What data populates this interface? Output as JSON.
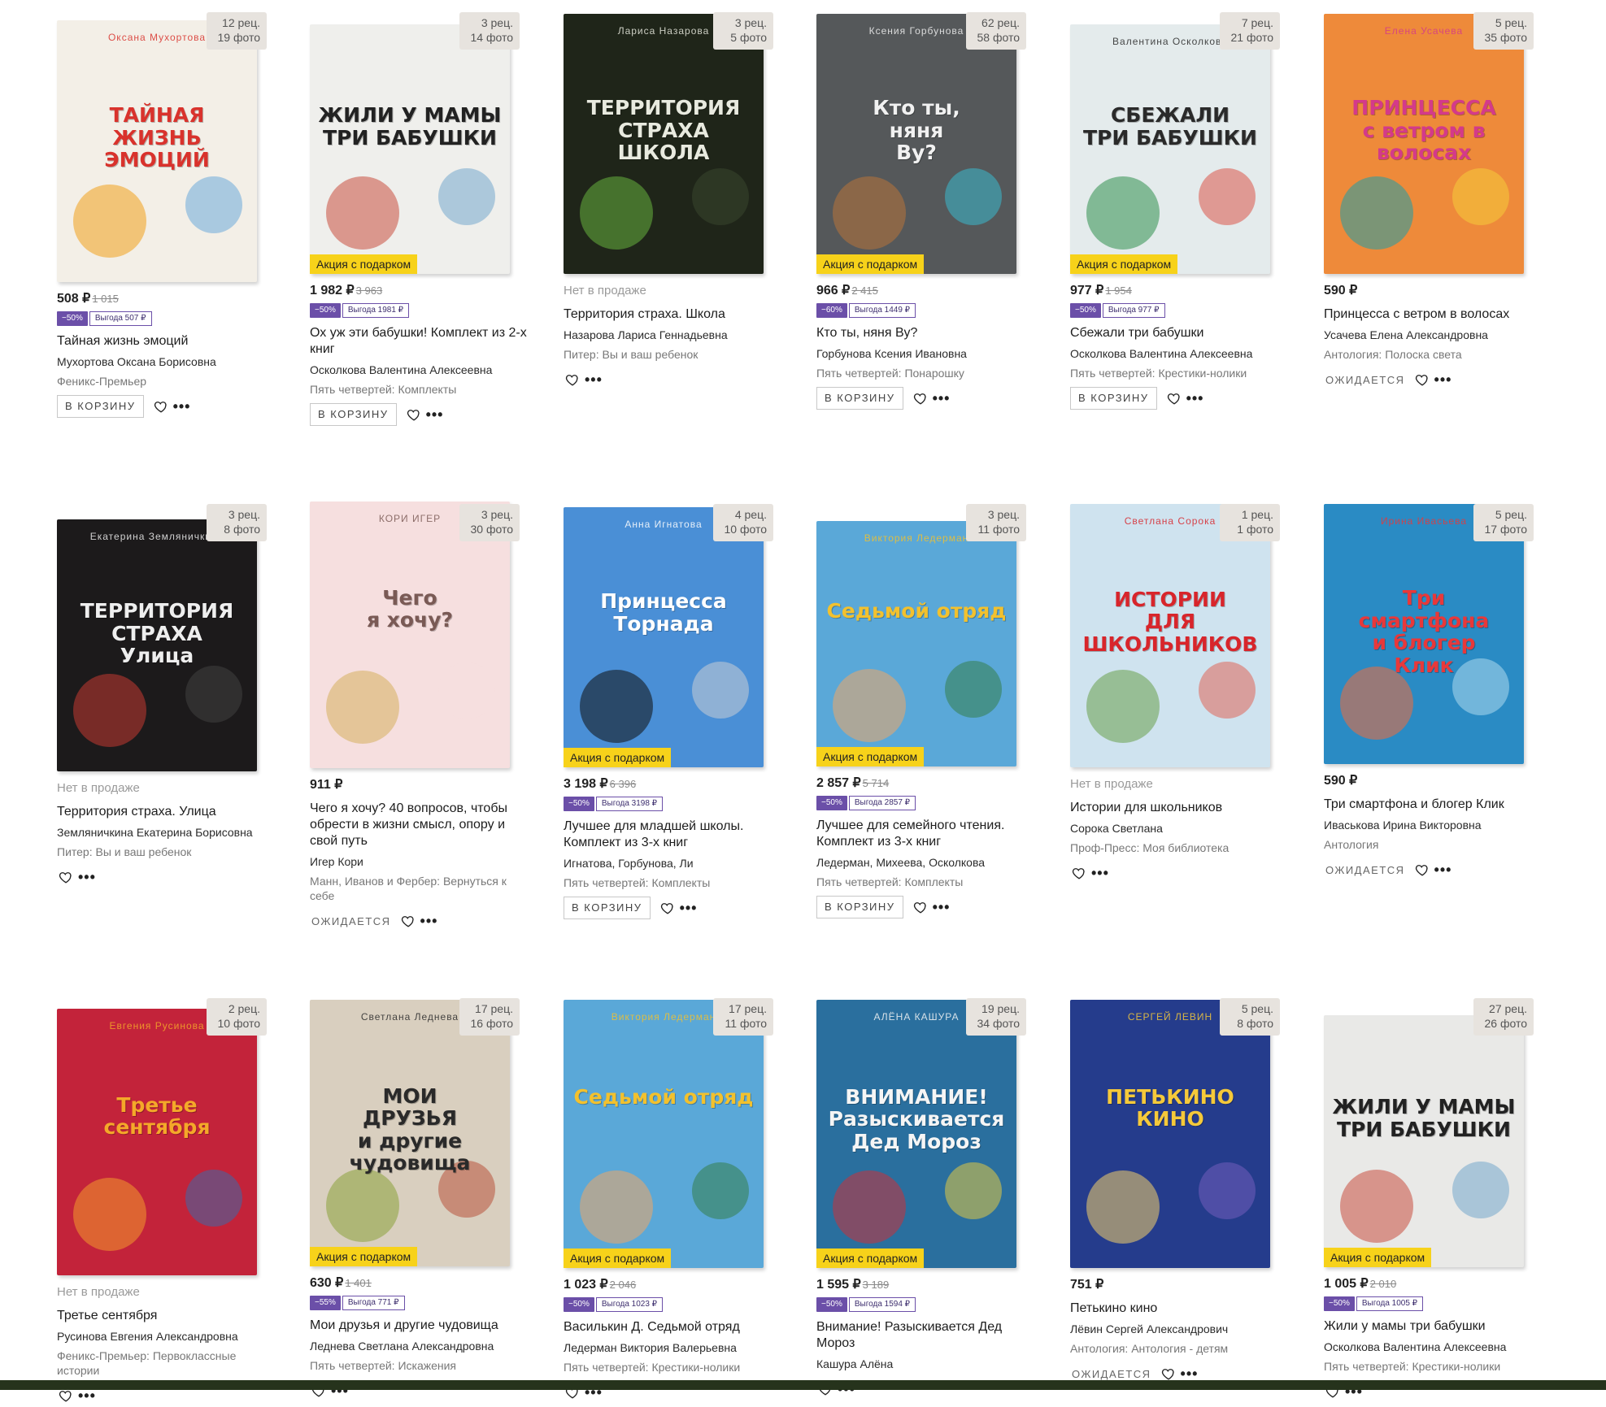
{
  "cards": [
    {
      "title": "Тайная жизнь эмоций",
      "author": "Мухортова Оксана Борисовна",
      "publisher": "Феникс-Премьер",
      "price": "508 ₽",
      "old_price": "1 015",
      "discount": "−50%",
      "saving": "Выгода 507 ₽",
      "reviews": "12 рец.",
      "photos": "19 фото",
      "promo": "",
      "status": "",
      "action": "В КОРЗИНУ",
      "cover_title": "ТАЙНАЯ\nЖИЗНЬ\nЭМОЦИЙ",
      "cover_author": "Оксана Мухортова",
      "cover_bg": "#f3efe7",
      "cover_fg": "#d9322c",
      "deco_a": "#f1a11c",
      "deco_b": "#5fa3d9"
    },
    {
      "title": "Ох уж эти бабушки! Комплект из 2-х книг",
      "author": "Осколкова Валентина Алексеевна",
      "publisher": "Пять четвертей: Комплекты",
      "price": "1 982 ₽",
      "old_price": "3 963",
      "discount": "−50%",
      "saving": "Выгода 1981 ₽",
      "reviews": "3 рец.",
      "photos": "14 фото",
      "promo": "Акция с подарком",
      "status": "",
      "action": "В КОРЗИНУ",
      "cover_title": "ЖИЛИ У МАМЫ\nТРИ БАБУШКИ",
      "cover_author": "",
      "cover_bg": "#efefec",
      "cover_fg": "#222222",
      "deco_a": "#c94f3f",
      "deco_b": "#6aa1c9"
    },
    {
      "title": "Территория страха. Школа",
      "author": "Назарова Лариса Геннадьевна",
      "publisher": "Питер: Вы и ваш ребенок",
      "price": "",
      "old_price": "",
      "discount": "",
      "saving": "",
      "reviews": "3 рец.",
      "photos": "5 фото",
      "promo": "",
      "status": "Нет в продаже",
      "action": "",
      "cover_title": "ТЕРРИТОРИЯ\nСТРАХА\nШКОЛА",
      "cover_author": "Лариса Назарова",
      "cover_bg": "#1f2519",
      "cover_fg": "#e8eadf",
      "deco_a": "#66b33e",
      "deco_b": "#3b4a30"
    },
    {
      "title": "Кто ты, няня Ву?",
      "author": "Горбунова Ксения Ивановна",
      "publisher": "Пять четвертей: Понарошку",
      "price": "966 ₽",
      "old_price": "2 415",
      "discount": "−60%",
      "saving": "Выгода 1449 ₽",
      "reviews": "62 рец.",
      "photos": "58 фото",
      "promo": "Акция с подарком",
      "status": "",
      "action": "В КОРЗИНУ",
      "cover_title": "Кто ты,\nняня\nВу?",
      "cover_author": "Ксения Горбунова",
      "cover_bg": "#55585a",
      "cover_fg": "#f1f1f1",
      "deco_a": "#b8743a",
      "deco_b": "#38c2d8"
    },
    {
      "title": "Сбежали три бабушки",
      "author": "Осколкова Валентина Алексеевна",
      "publisher": "Пять четвертей: Крестики-нолики",
      "price": "977 ₽",
      "old_price": "1 954",
      "discount": "−50%",
      "saving": "Выгода 977 ₽",
      "reviews": "7 рец.",
      "photos": "21 фото",
      "promo": "Акция с подарком",
      "status": "",
      "action": "В КОРЗИНУ",
      "cover_title": "СБЕЖАЛИ\nТРИ БАБУШКИ",
      "cover_author": "Валентина Осколкова",
      "cover_bg": "#e4ebec",
      "cover_fg": "#2a2a2a",
      "deco_a": "#2f8f4e",
      "deco_b": "#d9483a"
    },
    {
      "title": "Принцесса с ветром в волосах",
      "author": "Усачева Елена Александровна",
      "publisher": "Антология: Полоска света",
      "price": "590 ₽",
      "old_price": "",
      "discount": "",
      "saving": "",
      "reviews": "5 рец.",
      "photos": "35 фото",
      "promo": "",
      "status": "",
      "action": "ОЖИДАЕТСЯ",
      "cover_title": "ПРИНЦЕССА\nс ветром в волосах",
      "cover_author": "Елена Усачева",
      "cover_bg": "#ee8a3a",
      "cover_fg": "#d43a8a",
      "deco_a": "#1d9ea8",
      "deco_b": "#f5d23a"
    },
    {
      "title": "Территория страха. Улица",
      "author": "Земляничкина Екатерина Борисовна",
      "publisher": "Питер: Вы и ваш ребенок",
      "price": "",
      "old_price": "",
      "discount": "",
      "saving": "",
      "reviews": "3 рец.",
      "photos": "8 фото",
      "promo": "",
      "status": "Нет в продаже",
      "action": "",
      "cover_title": "ТЕРРИТОРИЯ\nСТРАХА\nУлица",
      "cover_author": "Екатерина Земляничкина",
      "cover_bg": "#1c1a1b",
      "cover_fg": "#eeeeee",
      "deco_a": "#c43a32",
      "deco_b": "#444444"
    },
    {
      "title": "Чего я хочу? 40 вопросов, чтобы обрести в жизни смысл, опору и свой путь",
      "author": "Игер Кори",
      "publisher": "Манн, Иванов и Фербер: Вернуться к себе",
      "price": "911 ₽",
      "old_price": "",
      "discount": "",
      "saving": "",
      "reviews": "3 рец.",
      "photos": "30 фото",
      "promo": "",
      "status": "",
      "action": "ОЖИДАЕТСЯ",
      "cover_title": "Чего\nя хочу?",
      "cover_author": "КОРИ ИГЕР",
      "cover_bg": "#f6dfdf",
      "cover_fg": "#7a5a55",
      "deco_a": "#d6ae5c",
      "deco_b": "#f6dfdf"
    },
    {
      "title": "Лучшее для младшей школы. Комплект из 3-х книг",
      "author": "Игнатова, Горбунова, Ли",
      "publisher": "Пять четвертей: Комплекты",
      "price": "3 198 ₽",
      "old_price": "6 396",
      "discount": "−50%",
      "saving": "Выгода 3198 ₽",
      "reviews": "4 рец.",
      "photos": "10 фото",
      "promo": "Акция с подарком",
      "status": "",
      "action": "В КОРЗИНУ",
      "cover_title": "Принцесса\nТорнада",
      "cover_author": "Анна Игнатова",
      "cover_bg": "#4a8fd6",
      "cover_fg": "#ffffff",
      "deco_a": "#111111",
      "deco_b": "#d3d3d3"
    },
    {
      "title": "Лучшее для семейного чтения. Комплект из 3-х книг",
      "author": "Ледерман, Михеева, Осколкова",
      "publisher": "Пять четвертей: Комплекты",
      "price": "2 857 ₽",
      "old_price": "5 714",
      "discount": "−50%",
      "saving": "Выгода 2857 ₽",
      "reviews": "3 рец.",
      "photos": "11 фото",
      "promo": "Акция с подарком",
      "status": "",
      "action": "В КОРЗИНУ",
      "cover_title": "Седьмой отряд",
      "cover_author": "Виктория Ледерман",
      "cover_bg": "#5aa8d8",
      "cover_fg": "#f2c12e",
      "deco_a": "#f0a566",
      "deco_b": "#2f7a3e"
    },
    {
      "title": "Истории для школьников",
      "author": "Сорока Светлана",
      "publisher": "Проф-Пресс: Моя библиотека",
      "price": "",
      "old_price": "",
      "discount": "",
      "saving": "",
      "reviews": "1 рец.",
      "photos": "1 фото",
      "promo": "",
      "status": "Нет в продаже",
      "action": "",
      "cover_title": "ИСТОРИИ\nДЛЯ ШКОЛЬНИКОВ",
      "cover_author": "Светлана Сорока",
      "cover_bg": "#cfe3ef",
      "cover_fg": "#d8252b",
      "deco_a": "#6aa04a",
      "deco_b": "#e25a4a"
    },
    {
      "title": "Три смартфона и блогер Клик",
      "author": "Иваськова Ирина Викторовна",
      "publisher": "Антология",
      "price": "590 ₽",
      "old_price": "",
      "discount": "",
      "saving": "",
      "reviews": "5 рец.",
      "photos": "17 фото",
      "promo": "",
      "status": "",
      "action": "ОЖИДАЕТСЯ",
      "cover_title": "Три\nсмартфона\nи блогер\nКлик",
      "cover_author": "Ирина Ивасьева",
      "cover_bg": "#2a8bc4",
      "cover_fg": "#e8383a",
      "deco_a": "#f26b3a",
      "deco_b": "#b9e1f1"
    },
    {
      "title": "Третье сентября",
      "author": "Русинова Евгения Александровна",
      "publisher": "Феникс-Премьер: Первоклассные истории",
      "price": "",
      "old_price": "",
      "discount": "",
      "saving": "",
      "reviews": "2 рец.",
      "photos": "10 фото",
      "promo": "",
      "status": "Нет в продаже",
      "action": "",
      "cover_title": "Третье\nсентября",
      "cover_author": "Евгения Русинова",
      "cover_bg": "#c3233a",
      "cover_fg": "#f4a829",
      "deco_a": "#f39a2c",
      "deco_b": "#2f6fb2"
    },
    {
      "title": "Мои друзья и другие чудовища",
      "author": "Леднева Светлана Александровна",
      "publisher": "Пять четвертей: Искажения",
      "price": "630 ₽",
      "old_price": "1 401",
      "discount": "−55%",
      "saving": "Выгода 771 ₽",
      "reviews": "17 рец.",
      "photos": "16 фото",
      "promo": "Акция с подарком",
      "status": "",
      "action": "",
      "cover_title": "МОИ\nДРУЗЬЯ\nи другие\nчудовища",
      "cover_author": "Светлана Леднева",
      "cover_bg": "#d9cfbf",
      "cover_fg": "#2a2a2a",
      "deco_a": "#8aa33a",
      "deco_b": "#b5472f"
    },
    {
      "title": "Василькин Д. Седьмой отряд",
      "author": "Ледерман Виктория Валерьевна",
      "publisher": "Пять четвертей: Крестики-нолики",
      "price": "1 023 ₽",
      "old_price": "2 046",
      "discount": "−50%",
      "saving": "Выгода 1023 ₽",
      "reviews": "17 рец.",
      "photos": "11 фото",
      "promo": "Акция с подарком",
      "status": "",
      "action": "",
      "cover_title": "Седьмой отряд",
      "cover_author": "Виктория Ледерман",
      "cover_bg": "#5aa8d8",
      "cover_fg": "#f2c12e",
      "deco_a": "#f0a566",
      "deco_b": "#2f7a3e"
    },
    {
      "title": "Внимание! Разыскивается Дед Мороз",
      "author": "Кашура Алёна",
      "publisher": "",
      "price": "1 595 ₽",
      "old_price": "3 189",
      "discount": "−50%",
      "saving": "Выгода 1594 ₽",
      "reviews": "19 рец.",
      "photos": "34 фото",
      "promo": "Акция с подарком",
      "status": "",
      "action": "",
      "cover_title": "ВНИМАНИЕ!\nРазыскивается\nДед Мороз",
      "cover_author": "АЛЁНА КАШУРА",
      "cover_bg": "#2a6f9e",
      "cover_fg": "#f5f5f5",
      "deco_a": "#c8313a",
      "deco_b": "#f2d23a"
    },
    {
      "title": "Петькино кино",
      "author": "Лёвин Сергей Александрович",
      "publisher": "Антология: Антология - детям",
      "price": "751 ₽",
      "old_price": "",
      "discount": "",
      "saving": "",
      "reviews": "5 рец.",
      "photos": "8 фото",
      "promo": "",
      "status": "",
      "action": "ОЖИДАЕТСЯ",
      "cover_title": "ПЕТЬКИНО\nКИНО",
      "cover_author": "СЕРГЕЙ ЛЕВИН",
      "cover_bg": "#253c8c",
      "cover_fg": "#f5c93a",
      "deco_a": "#f4d06a",
      "deco_b": "#7a5fbf"
    },
    {
      "title": "Жили у мамы три бабушки",
      "author": "Осколкова Валентина Алексеевна",
      "publisher": "Пять четвертей: Крестики-нолики",
      "price": "1 005 ₽",
      "old_price": "2 010",
      "discount": "−50%",
      "saving": "Выгода 1005 ₽",
      "reviews": "27 рец.",
      "photos": "26 фото",
      "promo": "Акция с подарком",
      "status": "",
      "action": "",
      "cover_title": "ЖИЛИ У МАМЫ\nТРИ БАБУШКИ",
      "cover_author": "",
      "cover_bg": "#e9e9e7",
      "cover_fg": "#222222",
      "deco_a": "#c94f3f",
      "deco_b": "#6aa1c9"
    }
  ]
}
